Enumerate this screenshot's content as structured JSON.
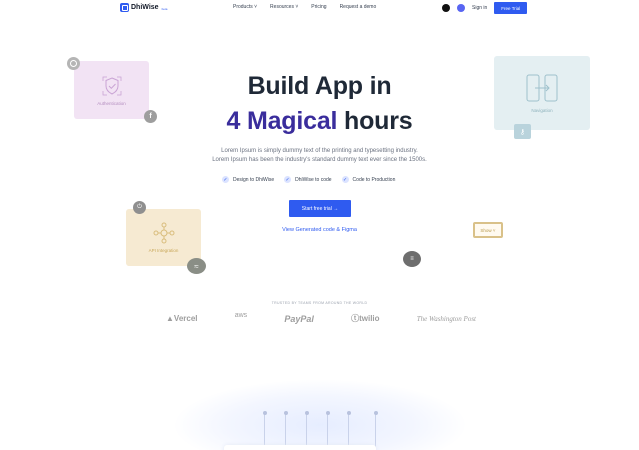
{
  "nav": {
    "brand": "DhiWise",
    "brand_badge": "beta",
    "menu": [
      "Products ˅",
      "Resources ˅",
      "Pricing",
      "Request a demo"
    ],
    "github_icon": "github-icon",
    "discord_icon": "discord-icon",
    "sign_in": "Sign in",
    "free_trial": "Free Trial"
  },
  "hero": {
    "title_line1": "Build App in",
    "title_accent": "4 Magical",
    "title_rest": " hours",
    "subtitle_line1": "Lorem Ipsum is simply dummy text of the printing and typesetting industry.",
    "subtitle_line2": "Lorem Ipsum has been the industry's standard dummy text ever since the 1500s.",
    "checks": [
      "Design to DhiWise",
      "DhiWise to code",
      "Code to Production"
    ],
    "cta": "Start free trial →",
    "secondary_link": "View Generated code & Figma"
  },
  "cards": {
    "auth": "Authentication",
    "navigation": "Navigation",
    "api": "API Integration",
    "dropdown": "Show ˅"
  },
  "trusted": {
    "caption": "TRUSTED BY TEAMS FROM AROUND THE WORLD",
    "logos": [
      "▲Vercel",
      "aws",
      "PayPal",
      "ⓣtwilio",
      "The Washington Post"
    ]
  },
  "colors": {
    "accent": "#2f5bf0",
    "title_accent": "#3a2d9c",
    "auth_card": "#f2e3f4",
    "nav_card": "#e4eff2",
    "api_card": "#f6ead2"
  }
}
